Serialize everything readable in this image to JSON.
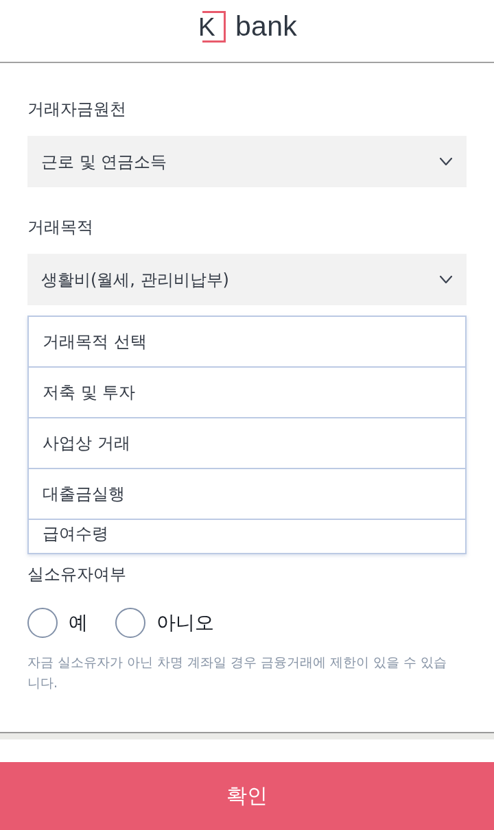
{
  "header": {
    "logo": {
      "mark": "K",
      "name": "bank"
    }
  },
  "fields": [
    {
      "kind": "select",
      "label": "거래자금원천",
      "value": "근로 및 연금소득"
    },
    {
      "kind": "select",
      "label": "거래목적",
      "value": "생활비(월세, 관리비납부)",
      "options": [
        {
          "label": "거래목적 선택",
          "selected": false
        },
        {
          "label": "저축 및 투자",
          "selected": false
        },
        {
          "label": "사업상 거래",
          "selected": false
        },
        {
          "label": "대출금실행",
          "selected": false
        },
        {
          "label": "급여수령",
          "selected": false
        }
      ]
    }
  ],
  "ownership": {
    "label": "실소유자여부",
    "options": [
      {
        "label": "예",
        "selected": false
      },
      {
        "label": "아니오",
        "selected": false
      }
    ],
    "note": "자금 실소유자가 아닌 차명 계좌일 경우 금융거래에 제한이 있을 수 있습니다."
  },
  "confirm_button": {
    "label": "확인"
  }
}
